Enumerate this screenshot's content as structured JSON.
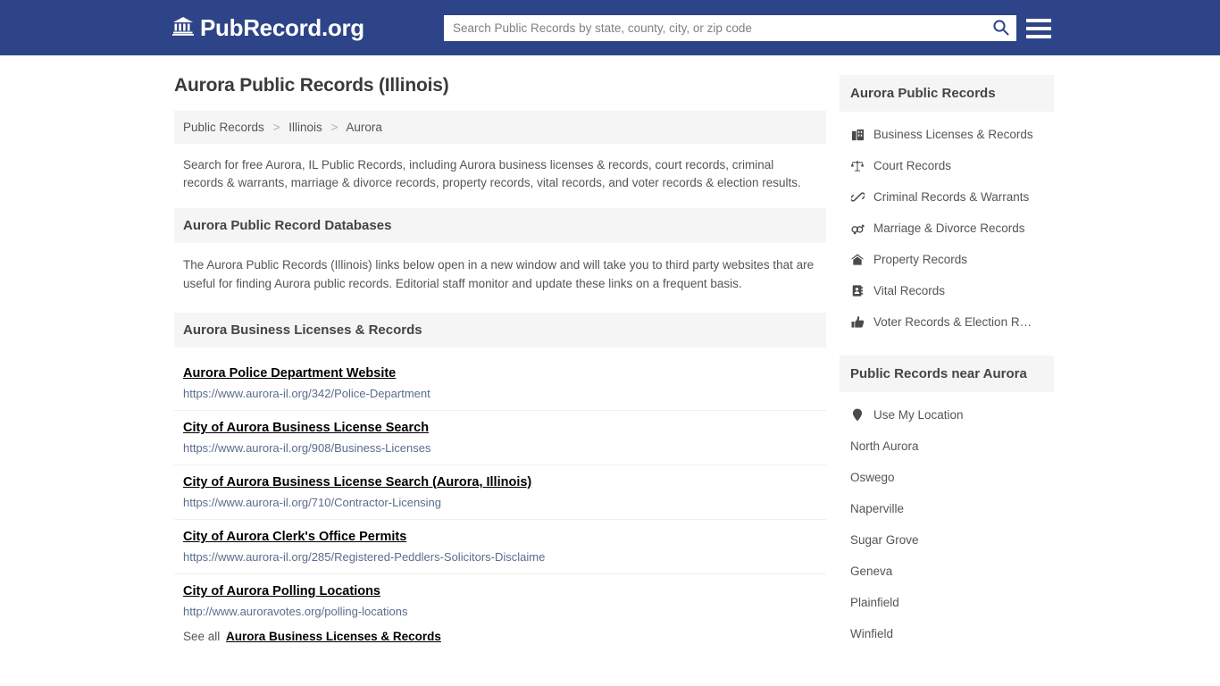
{
  "header": {
    "logo_text": "PubRecord.org",
    "logo_icon": "bank-building-icon",
    "search_placeholder": "Search Public Records by state, county, city, or zip code",
    "search_value": "",
    "search_icon": "search-icon",
    "menu_icon": "hamburger-menu-icon",
    "background_color": "#2e4488"
  },
  "main": {
    "page_title": "Aurora Public Records (Illinois)",
    "breadcrumb": [
      {
        "label": "Public Records"
      },
      {
        "label": "Illinois"
      },
      {
        "label": "Aurora"
      }
    ],
    "breadcrumb_separator": ">",
    "intro": "Search for free Aurora, IL Public Records, including Aurora business licenses & records, court records, criminal records & warrants, marriage & divorce records, property records, vital records, and voter records & election results.",
    "databases_section": {
      "heading": "Aurora Public Record Databases",
      "body": "The Aurora Public Records (Illinois) links below open in a new window and will take you to third party websites that are useful for finding Aurora public records. Editorial staff monitor and update these links on a frequent basis."
    },
    "business_section": {
      "heading": "Aurora Business Licenses & Records",
      "links": [
        {
          "title": "Aurora Police Department Website",
          "url": "https://www.aurora-il.org/342/Police-Department"
        },
        {
          "title": "City of Aurora Business License Search",
          "url": "https://www.aurora-il.org/908/Business-Licenses"
        },
        {
          "title": "City of Aurora Business License Search (Aurora, Illinois)",
          "url": "https://www.aurora-il.org/710/Contractor-Licensing"
        },
        {
          "title": "City of Aurora Clerk's Office Permits",
          "url": "https://www.aurora-il.org/285/Registered-Peddlers-Solicitors-Disclaime"
        },
        {
          "title": "City of Aurora Polling Locations",
          "url": "http://www.auroravotes.org/polling-locations"
        }
      ],
      "see_all_prefix": "See all",
      "see_all_label": "Aurora Business Licenses & Records"
    }
  },
  "sidebar": {
    "records": {
      "heading": "Aurora Public Records",
      "items": [
        {
          "label": "Business Licenses & Records",
          "icon": "briefcase-icon"
        },
        {
          "label": "Court Records",
          "icon": "scales-of-justice-icon"
        },
        {
          "label": "Criminal Records & Warrants",
          "icon": "handcuffs-icon"
        },
        {
          "label": "Marriage & Divorce Records",
          "icon": "gender-symbols-icon"
        },
        {
          "label": "Property Records",
          "icon": "home-icon"
        },
        {
          "label": "Vital Records",
          "icon": "address-book-icon"
        },
        {
          "label": "Voter Records & Election R…",
          "icon": "thumbs-up-icon"
        }
      ]
    },
    "nearby": {
      "heading": "Public Records near Aurora",
      "use_my_location": {
        "label": "Use My Location",
        "icon": "map-pin-icon"
      },
      "cities": [
        {
          "label": "North Aurora"
        },
        {
          "label": "Oswego"
        },
        {
          "label": "Naperville"
        },
        {
          "label": "Sugar Grove"
        },
        {
          "label": "Geneva"
        },
        {
          "label": "Plainfield"
        },
        {
          "label": "Winfield"
        }
      ]
    }
  }
}
